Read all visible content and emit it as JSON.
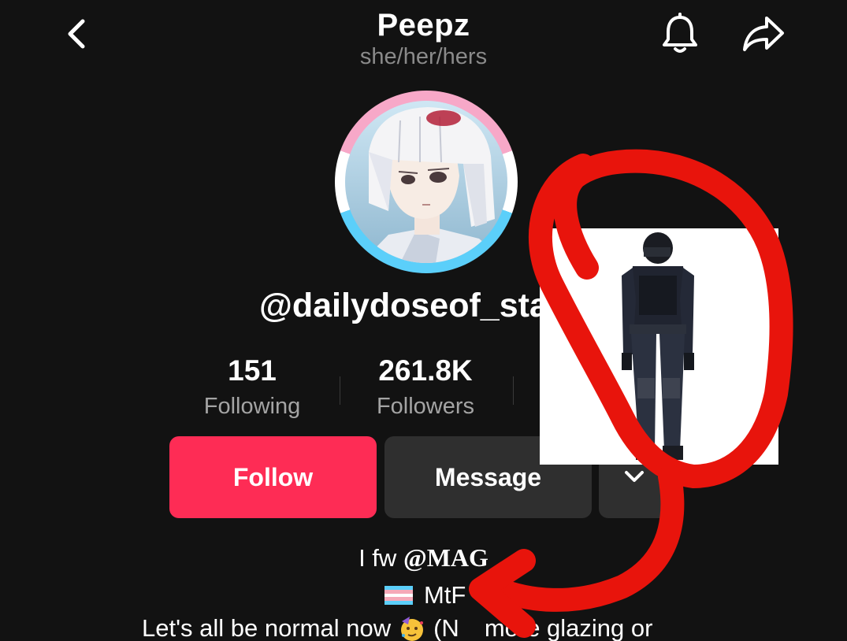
{
  "header": {
    "title": "Peepz",
    "pronouns": "she/her/hers",
    "back_icon": "chevron-left-icon",
    "notification_icon": "bell-icon",
    "share_icon": "share-arrow-icon"
  },
  "profile": {
    "handle": "@dailydoseof_starw",
    "avatar_ring_colors": [
      "#5bcffa",
      "#f7a8c8",
      "#ffffff"
    ]
  },
  "stats": {
    "following": {
      "value": "151",
      "label": "Following"
    },
    "followers": {
      "value": "261.8K",
      "label": "Followers"
    }
  },
  "actions": {
    "follow_label": "Follow",
    "message_label": "Message",
    "follow_color": "#fe2c55",
    "secondary_color": "#2f2f2f"
  },
  "bio": {
    "line1_prefix": "I fw",
    "line1_mention": "@MAG",
    "line2_text": "MtF",
    "line3_start": "Let's all be normal now",
    "line3_end": "(N",
    "line3_tail": "more glazing or"
  },
  "overlay": {
    "scribble_color": "#e8140c"
  }
}
